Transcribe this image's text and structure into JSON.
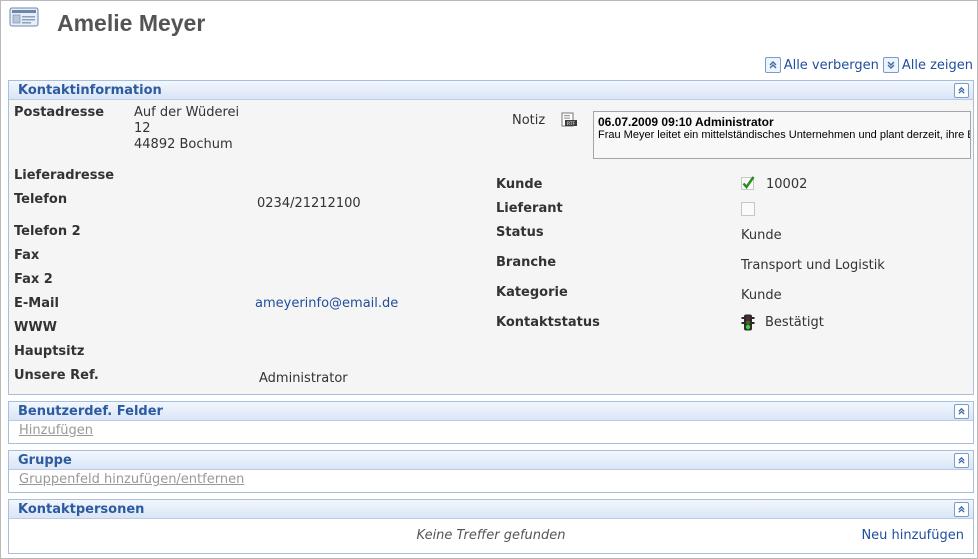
{
  "header": {
    "title": "Amelie Meyer",
    "icon": "contact-card-icon"
  },
  "toolbar": {
    "hide_all": "Alle verbergen",
    "show_all": "Alle zeigen"
  },
  "kontakt": {
    "title": "Kontaktinformation",
    "postadresse_label": "Postadresse",
    "postadresse": [
      "Auf der Wüderei",
      "12",
      "44892 Bochum"
    ],
    "lieferadresse_label": "Lieferadresse",
    "telefon_label": "Telefon",
    "telefon": "0234/21212100",
    "telefon2_label": "Telefon 2",
    "fax_label": "Fax",
    "fax2_label": "Fax 2",
    "email_label": "E-Mail",
    "email": "ameyerinfo@email.de",
    "www_label": "WWW",
    "hauptsitz_label": "Hauptsitz",
    "unsere_ref_label": "Unsere Ref.",
    "unsere_ref": "Administrator",
    "notiz_label": "Notiz",
    "notiz_head": "06.07.2009 09:10 Administrator",
    "notiz_text": "Frau Meyer leitet ein mittelständisches Unternehmen und plant derzeit, ihre Büro",
    "kunde_label": "Kunde",
    "kunde_value": "10002",
    "kunde_checked": true,
    "lieferant_label": "Lieferant",
    "lieferant_checked": false,
    "status_label": "Status",
    "status": "Kunde",
    "branche_label": "Branche",
    "branche": "Transport und Logistik",
    "kategorie_label": "Kategorie",
    "kategorie": "Kunde",
    "kontaktstatus_label": "Kontaktstatus",
    "kontaktstatus": "Bestätigt"
  },
  "benutzer": {
    "title": "Benutzerdef. Felder",
    "add_link": "Hinzufügen"
  },
  "gruppe": {
    "title": "Gruppe",
    "link": "Gruppenfeld hinzufügen/entfernen"
  },
  "personen": {
    "title": "Kontaktpersonen",
    "empty": "Keine Treffer gefunden",
    "new_link": "Neu hinzufügen"
  },
  "colors": {
    "accent": "#2c5ba0",
    "link": "#1f4e9c",
    "check": "#2a8a1e"
  }
}
